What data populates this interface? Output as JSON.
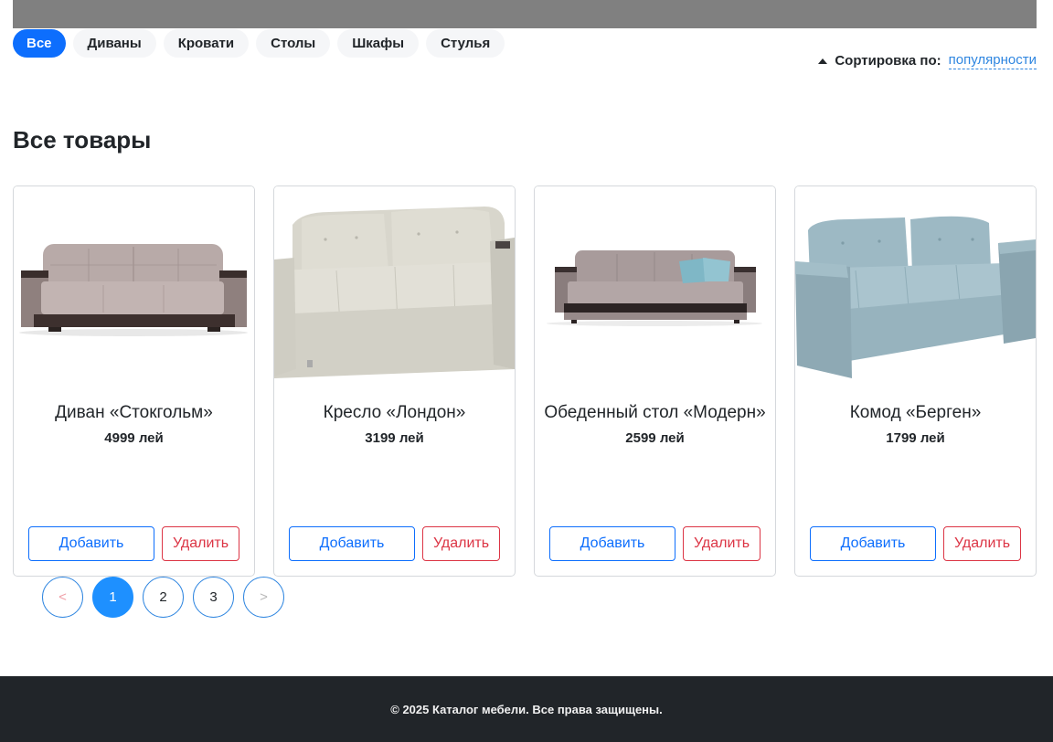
{
  "filters": {
    "tabs": [
      {
        "label": "Все",
        "active": true
      },
      {
        "label": "Диваны",
        "active": false
      },
      {
        "label": "Кровати",
        "active": false
      },
      {
        "label": "Столы",
        "active": false
      },
      {
        "label": "Шкафы",
        "active": false
      },
      {
        "label": "Стулья",
        "active": false
      }
    ]
  },
  "sort": {
    "label": "Сортировка по:",
    "value": "популярности",
    "direction_icon": "sort-up-arrow-icon"
  },
  "section": {
    "title": "Все товары"
  },
  "products": [
    {
      "name": "Диван «Стокгольм»",
      "price": "4999 лей",
      "image": "sofa-mauve-image",
      "add_label": "Добавить",
      "remove_label": "Удалить"
    },
    {
      "name": "Кресло «Лондон»",
      "price": "3199 лей",
      "image": "sofa-cream-image",
      "add_label": "Добавить",
      "remove_label": "Удалить"
    },
    {
      "name": "Обеденный стол «Модерн»",
      "price": "2599 лей",
      "image": "sofa-taupe-pillows-image",
      "add_label": "Добавить",
      "remove_label": "Удалить"
    },
    {
      "name": "Комод «Берген»",
      "price": "1799 лей",
      "image": "sofa-blue-image",
      "add_label": "Добавить",
      "remove_label": "Удалить"
    }
  ],
  "pagination": {
    "prev": "<",
    "pages": [
      "1",
      "2",
      "3"
    ],
    "current": "1",
    "next": ">"
  },
  "footer": {
    "text": "© 2025 Каталог мебели. Все права защищены."
  },
  "colors": {
    "primary": "#0d6efd",
    "danger": "#dc3545",
    "footer_bg": "#212529",
    "top_bar": "#808080"
  }
}
